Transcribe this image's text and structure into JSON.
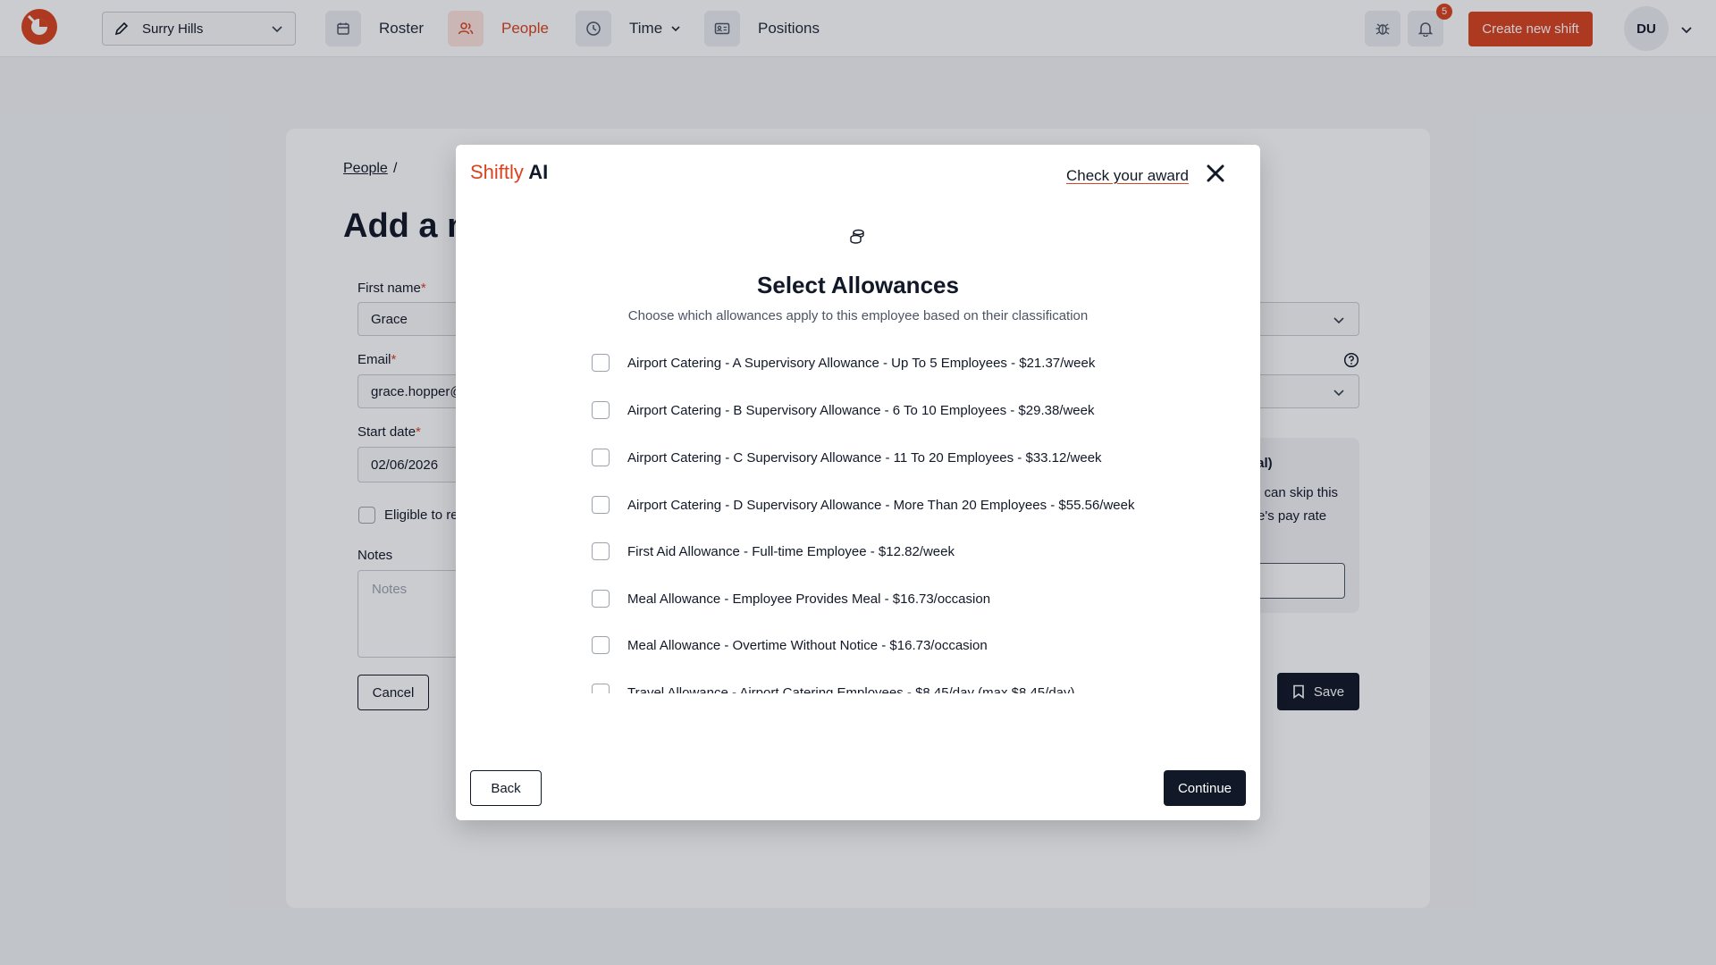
{
  "topbar": {
    "location": "Surry Hills",
    "nav": [
      {
        "label": "Roster",
        "icon": "calendar-icon"
      },
      {
        "label": "People",
        "icon": "people-icon",
        "active": true
      },
      {
        "label": "Time",
        "icon": "clock-icon"
      },
      {
        "label": "Positions",
        "icon": "id-card-icon"
      }
    ],
    "notification_count": "5",
    "create_shift_label": "Create new shift",
    "avatar_initials": "DU"
  },
  "form": {
    "breadcrumb_link": "People",
    "breadcrumb_sep": "/",
    "page_title": "Add a ne",
    "first_name_label": "First name",
    "first_name_value": "Grace",
    "email_label": "Email",
    "email_value": "grace.hopper@",
    "start_date_label": "Start date",
    "start_date_value": "02/06/2026",
    "eligible_label": "Eligible to re",
    "notes_label": "Notes",
    "notes_placeholder": "Notes",
    "cancel_label": "Cancel",
    "save_label": "Save",
    "required_mark": "*",
    "pay_panel_title": "nal)",
    "pay_panel_line1": "u can skip this",
    "pay_panel_line2": "e's pay rate"
  },
  "modal": {
    "brand_part1": "Shiftly",
    "brand_part2": " AI",
    "award_link": "Check your award",
    "title": "Select Allowances",
    "subtitle": "Choose which allowances apply to this employee based on their classification",
    "allowances": [
      "Airport Catering - A Supervisory Allowance - Up To 5 Employees - $21.37/week",
      "Airport Catering - B Supervisory Allowance - 6 To 10 Employees - $29.38/week",
      "Airport Catering - C Supervisory Allowance - 11 To 20 Employees - $33.12/week",
      "Airport Catering - D Supervisory Allowance - More Than 20 Employees - $55.56/week",
      "First Aid Allowance - Full-time Employee - $12.82/week",
      "Meal Allowance - Employee Provides Meal - $16.73/occasion",
      "Meal Allowance - Overtime Without Notice - $16.73/occasion",
      "Travel Allowance - Airport Catering Employees - $8.45/day (max $8.45/day)"
    ],
    "back_label": "Back",
    "continue_label": "Continue"
  },
  "colors": {
    "accent": "#d9431f",
    "dark": "#111827",
    "overlay": "rgba(17,24,39,0.22)"
  }
}
